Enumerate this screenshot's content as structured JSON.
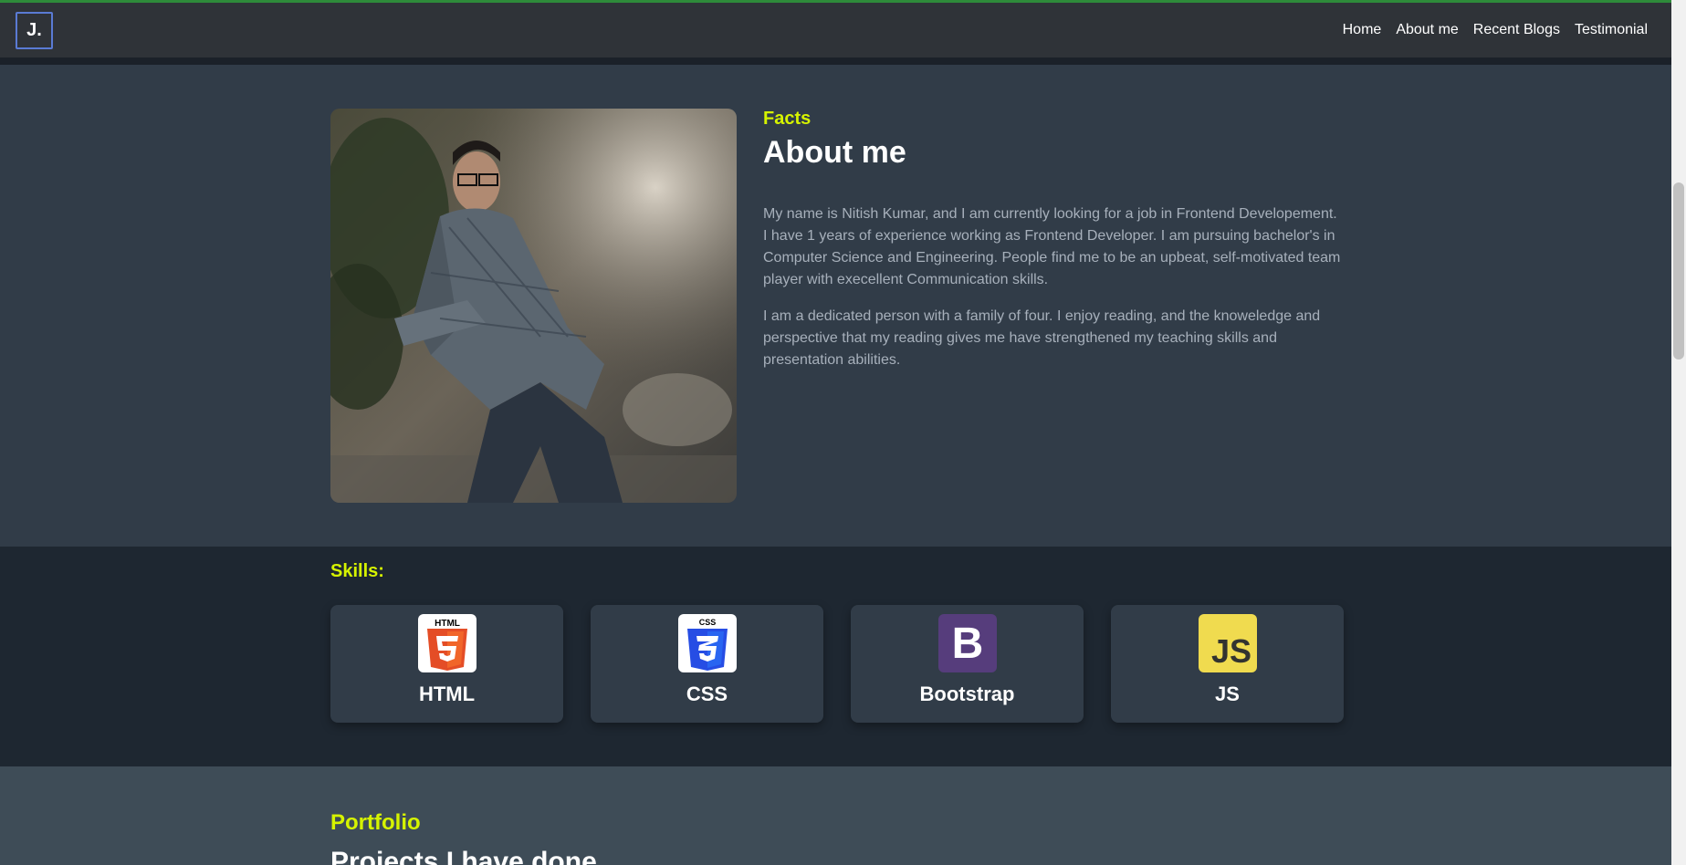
{
  "navbar": {
    "brand": "J.",
    "links": [
      "Home",
      "About me",
      "Recent Blogs",
      "Testimonial"
    ]
  },
  "about": {
    "eyebrow": "Facts",
    "title": "About me",
    "paragraphs": [
      "My name is Nitish Kumar, and I am currently looking for a job in Frontend Developement. I have 1 years of experience working as Frontend Developer. I am pursuing bachelor's in Computer Science and Engineering. People find me to be an upbeat, self-motivated team player with execellent Communication skills.",
      "I am a dedicated person with a family of four. I enjoy reading, and the knoweledge and perspective that my reading gives me have strengthened my teaching skills and presentation abilities."
    ]
  },
  "skills": {
    "title": "Skills:",
    "items": [
      {
        "label": "HTML",
        "icon": "html5-icon",
        "color": "#e44d26",
        "logo_text": "HTML"
      },
      {
        "label": "CSS",
        "icon": "css3-icon",
        "color": "#264de4",
        "logo_text": "CSS"
      },
      {
        "label": "Bootstrap",
        "icon": "bootstrap-icon",
        "color": "#563d7c",
        "logo_text": "B"
      },
      {
        "label": "JS",
        "icon": "javascript-icon",
        "color": "#f0db4f",
        "logo_text": "JS"
      }
    ]
  },
  "portfolio": {
    "eyebrow": "Portfolio",
    "title": "Projects I have done"
  },
  "colors": {
    "accent": "#d6f300",
    "navbar": "#2f3338",
    "section_bg": "#313c48",
    "skills_bg": "#1e2731",
    "portfolio_bg": "#3e4c57"
  }
}
